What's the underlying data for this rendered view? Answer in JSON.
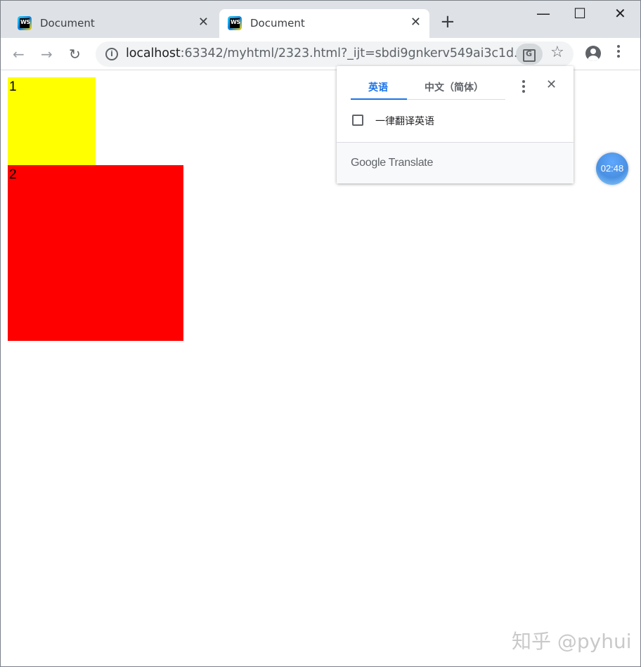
{
  "tabs": [
    {
      "title": "Document",
      "active": false
    },
    {
      "title": "Document",
      "active": true
    }
  ],
  "tab_favicon_text": "WS",
  "tab_close_glyph": "✕",
  "new_tab_glyph": "+",
  "window_controls": {
    "minimize": "—",
    "maximize": "☐",
    "close": "✕"
  },
  "nav": {
    "back": "←",
    "forward": "→",
    "reload": "↻"
  },
  "address": {
    "info_glyph": "i",
    "host": "localhost",
    "rest": ":63342/myhtml/2323.html?_ijt=sbdi9gnkerv549ai3c1d..."
  },
  "star_glyph": "☆",
  "translate_glyph": "G",
  "boxes": {
    "box1": {
      "label": "1",
      "color": "#ffff00"
    },
    "box2": {
      "label": "2",
      "color": "#ff0000"
    }
  },
  "translate_popup": {
    "tab_source": "英语",
    "tab_target": "中文（简体）",
    "close_glyph": "✕",
    "always_translate_label": "一律翻译英语",
    "always_translate_checked": false,
    "footer_brand": "Google Translate"
  },
  "timer": {
    "time": "02:48"
  },
  "watermark": "知乎 @pyhui"
}
